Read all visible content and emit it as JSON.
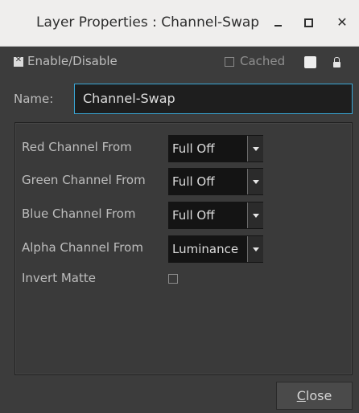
{
  "window": {
    "title": "Layer Properties : Channel-Swap",
    "controls": [
      "minimize-icon",
      "maximize-icon",
      "close-icon"
    ]
  },
  "top_row": {
    "enable_label": "Enable/Disable",
    "enable_checked": true,
    "cached_label": "Cached",
    "cached_checked": false,
    "color_swatch": "#eeeeee",
    "lock_icon": "lock-icon"
  },
  "name": {
    "label": "Name:",
    "value": "Channel-Swap",
    "focus_color": "#3aa7d6"
  },
  "channels": [
    {
      "label": "Red Channel From",
      "value": "Full Off"
    },
    {
      "label": "Green Channel From",
      "value": "Full Off"
    },
    {
      "label": "Blue Channel From",
      "value": "Full Off"
    },
    {
      "label": "Alpha Channel From",
      "value": "Luminance"
    }
  ],
  "invert_matte": {
    "label": "Invert Matte",
    "checked": false
  },
  "footer": {
    "close_label": "Close"
  }
}
